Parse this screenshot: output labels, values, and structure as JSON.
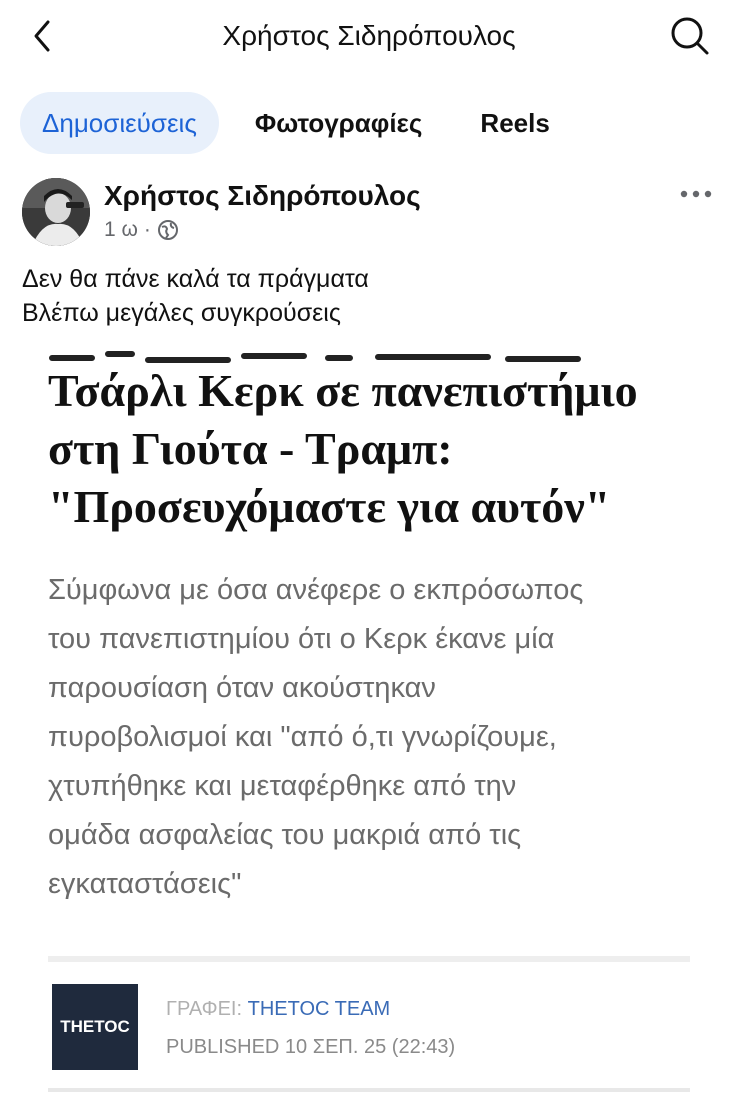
{
  "header": {
    "title": "Χρήστος Σιδηρόπουλος",
    "back_icon": "chevron-left-icon",
    "search_icon": "search-icon"
  },
  "tabs": [
    {
      "label": "Δημοσιεύσεις",
      "active": true
    },
    {
      "label": "Φωτογραφίες",
      "active": false
    },
    {
      "label": "Reels",
      "active": false
    }
  ],
  "post": {
    "author": "Χρήστος Σιδηρόπουλος",
    "time": "1 ω",
    "separator": "·",
    "audience_icon": "globe-icon",
    "more_icon": "more-horizontal-icon",
    "text_lines": [
      "Δεν θα πάνε καλά τα πράγματα",
      "Βλέπω μεγάλες συγκρούσεις"
    ]
  },
  "article": {
    "headline_lines": [
      "Τσάρλι Κερκ σε πανεπιστήμιο",
      "στη Γιούτα - Τραμπ:",
      "\"Προσευχόμαστε για αυτόν\""
    ],
    "lede_lines": [
      "Σύμφωνα με όσα ανέφερε ο εκπρόσωπος",
      "του πανεπιστημίου ότι ο Κερκ έκανε μία",
      "παρουσίαση όταν ακούστηκαν",
      "πυροβολισμοί και \"από ό,τι γνωρίζουμε,",
      "χτυπήθηκε και μεταφέρθηκε από την",
      "ομάδα ασφαλείας του μακριά από τις",
      "εγκαταστάσεις\""
    ],
    "logo_text": "THETOC",
    "byline_prefix": "ΓΡΑΦΕΙ:",
    "byline_author": "THETOC TEAM",
    "published": "PUBLISHED 10 ΣΕΠ. 25 (22:43)"
  },
  "colors": {
    "accent": "#1d63d6",
    "tab_active_bg": "#e8f0fb",
    "logo_bg": "#1f2a3d",
    "byline_author": "#3a6bb6"
  }
}
